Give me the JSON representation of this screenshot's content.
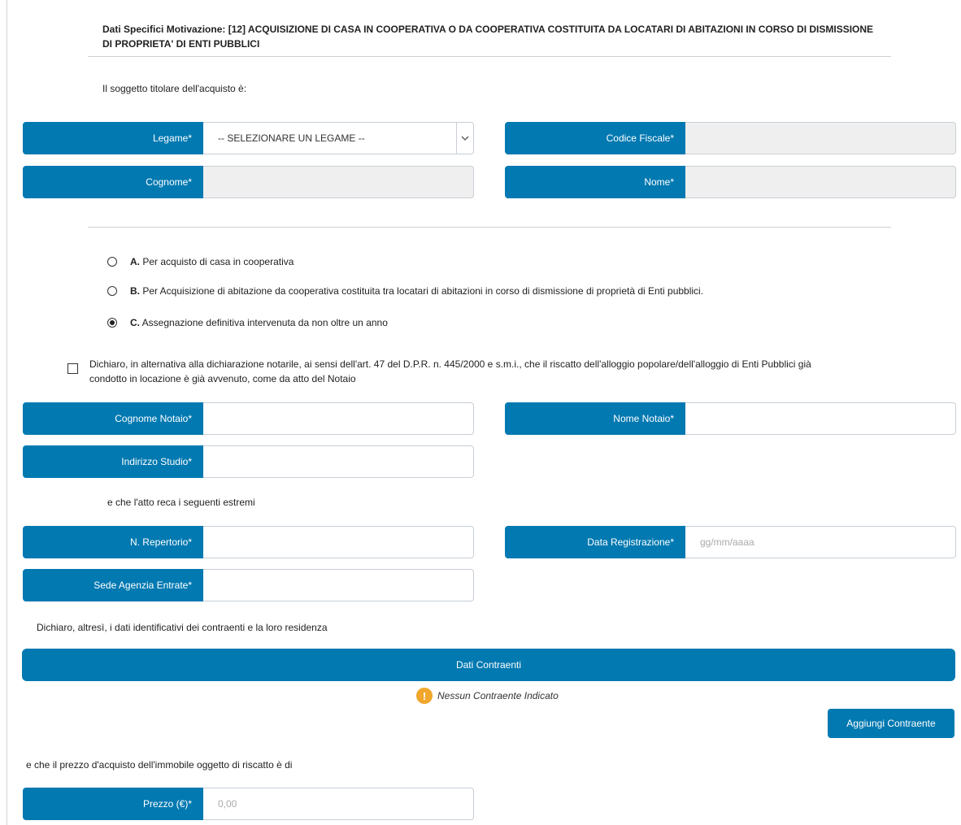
{
  "section": {
    "title": "Dati Specifici Motivazione: [12] ACQUISIZIONE DI CASA IN COOPERATIVA O DA COOPERATIVA COSTITUITA DA LOCATARI DI ABITAZIONI IN CORSO DI DISMISSIONE DI PROPRIETA' DI ENTI PUBBLICI",
    "subject_intro": "Il soggetto titolare dell'acquisto è:"
  },
  "holder": {
    "legame_label": "Legame*",
    "legame_value": "-- SELEZIONARE UN LEGAME --",
    "codice_fiscale_label": "Codice Fiscale*",
    "cognome_label": "Cognome*",
    "nome_label": "Nome*"
  },
  "options": {
    "a_letter": "A.",
    "a_text": " Per acquisto di casa in cooperativa",
    "b_letter": "B.",
    "b_text": " Per Acquisizione di abitazione da cooperativa costituita tra locatari di abitazioni in corso di dismissione di proprietà di Enti pubblici.",
    "c_letter": "C.",
    "c_text": " Assegnazione definitiva intervenuta da non oltre un anno",
    "selected": "C"
  },
  "declaration": {
    "line1": "Dichiaro, in alternativa alla dichiarazione notarile, ai sensi dell'art. 47 del D.P.R. n. 445/2000 e s.m.i., che il riscatto dell'alloggio popolare/dell'alloggio di Enti Pubblici già",
    "line2": "condotto in locazione è già avvenuto, come da atto del Notaio"
  },
  "notary": {
    "cognome_label": "Cognome Notaio*",
    "nome_label": "Nome Notaio*",
    "indirizzo_label": "Indirizzo Studio*"
  },
  "deed": {
    "intro": "e che l'atto reca i seguenti estremi",
    "repertorio_label": "N. Repertorio*",
    "data_label": "Data Registrazione*",
    "data_placeholder": "gg/mm/aaaa",
    "sede_label": "Sede Agenzia Entrate*"
  },
  "contractors": {
    "intro": "Dichiaro, altresì, i dati identificativi dei contraenti e la loro residenza",
    "bar_label": "Dati Contraenti",
    "warning_icon": "!",
    "empty_text": "Nessun Contraente Indicato",
    "add_button": "Aggiungi Contraente"
  },
  "price": {
    "intro": "e che il prezzo d'acquisto dell'immobile oggetto di riscatto è di",
    "label": "Prezzo (€)*",
    "placeholder": "0,00"
  },
  "colors": {
    "accent": "#0279b1",
    "warning": "#f0a72c",
    "disabled_bg": "#efefef"
  }
}
